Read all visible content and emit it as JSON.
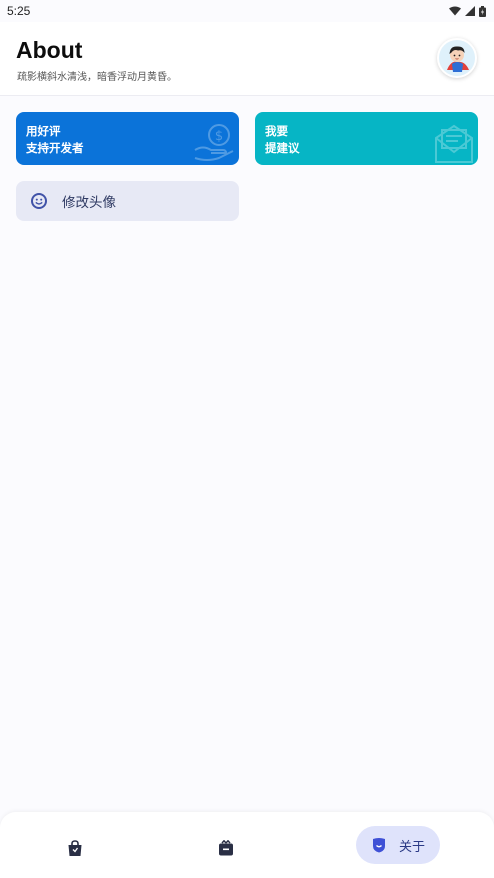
{
  "status_bar": {
    "time": "5:25",
    "icons": [
      "wifi-icon",
      "signal-icon",
      "battery-icon"
    ]
  },
  "header": {
    "title": "About",
    "subtitle": "疏影横斜水清浅，暗香浮动月黄昏。",
    "avatar_icon": "avatar-cartoon-boy"
  },
  "cards": {
    "rate": {
      "line1": "用好评",
      "line2": "支持开发者",
      "icon": "money-hand-icon",
      "color": "#0b73d9"
    },
    "suggest": {
      "line1": "我要",
      "line2": "提建议",
      "icon": "mail-letter-icon",
      "color": "#06b5c5"
    }
  },
  "change_avatar": {
    "label": "修改头像",
    "icon": "smiley-face-icon"
  },
  "bottom_nav": {
    "items": [
      {
        "icon": "shopping-bag-icon",
        "label": "",
        "active": false
      },
      {
        "icon": "toolbox-icon",
        "label": "",
        "active": false
      },
      {
        "icon": "about-shield-icon",
        "label": "关于",
        "active": true
      }
    ],
    "active_color": "#dfe3fb"
  }
}
